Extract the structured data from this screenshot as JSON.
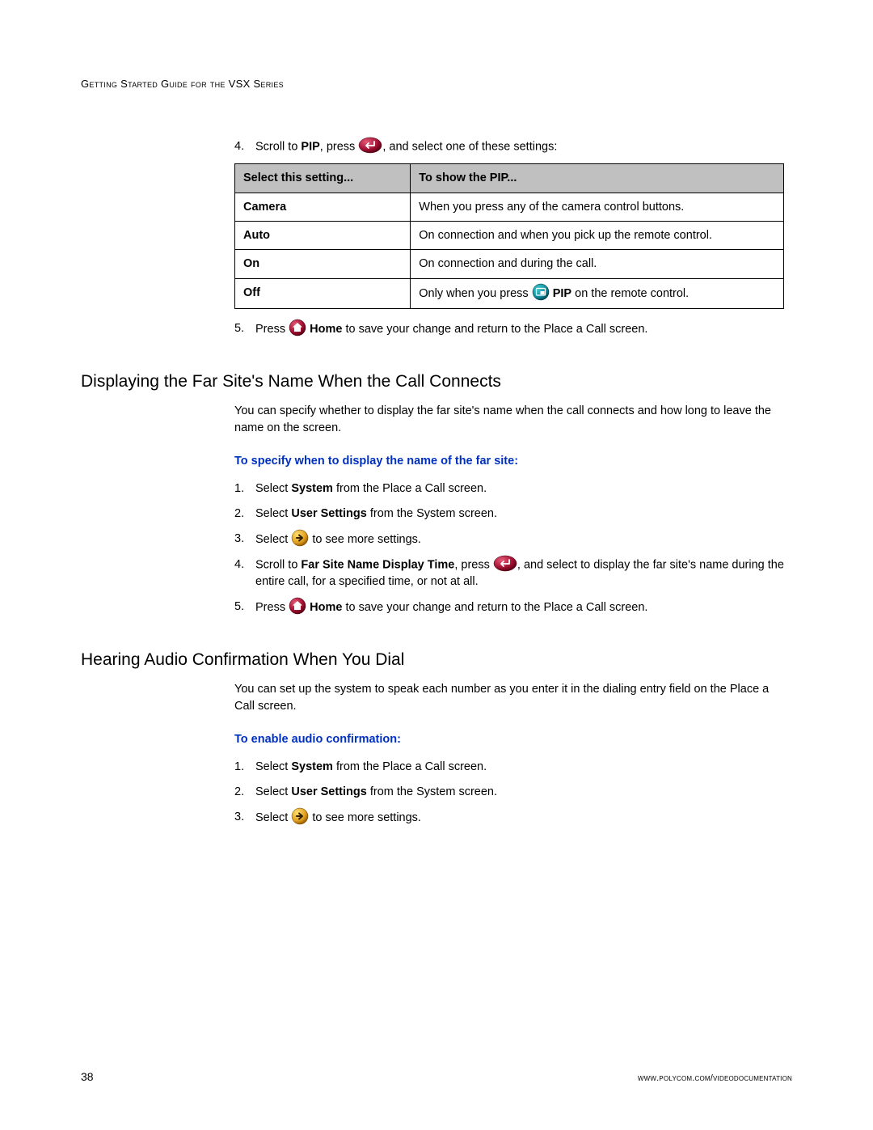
{
  "header": "Getting Started Guide for the VSX Series",
  "step4": {
    "num": "4.",
    "pre": "Scroll to ",
    "bold": "PIP",
    "mid": ", press ",
    "post": ", and select one of these settings:"
  },
  "table": {
    "h1": "Select this setting...",
    "h2": "To show the PIP...",
    "rows": [
      {
        "name": "Camera",
        "desc": "When you press any of the camera control buttons."
      },
      {
        "name": "Auto",
        "desc": "On connection and when you pick up the remote control."
      },
      {
        "name": "On",
        "desc": "On connection and during the call."
      },
      {
        "name": "Off",
        "desc_pre": "Only when you press ",
        "desc_bold": "PIP",
        "desc_post": " on the remote control."
      }
    ]
  },
  "step5": {
    "num": "5.",
    "pre": "Press ",
    "bold": "Home",
    "post": " to save your change and return to the Place a Call screen."
  },
  "sectionA": {
    "title": "Displaying the Far Site's Name When the Call Connects",
    "intro": "You can specify whether to display the far site's name when the call connects and how long to leave the name on the screen.",
    "task": "To specify when to display the name of the far site:",
    "s1": {
      "num": "1.",
      "pre": "Select ",
      "bold": "System",
      "post": " from the Place a Call screen."
    },
    "s2": {
      "num": "2.",
      "pre": "Select ",
      "bold": "User Settings",
      "post": " from the System screen."
    },
    "s3": {
      "num": "3.",
      "pre": "Select ",
      "post": " to see more settings."
    },
    "s4": {
      "num": "4.",
      "pre": "Scroll to ",
      "bold": "Far Site Name Display Time",
      "mid": ", press ",
      "post": ", and select to display the far site's name during the entire call, for a specified time, or not at all."
    },
    "s5": {
      "num": "5.",
      "pre": "Press ",
      "bold": "Home",
      "post": " to save your change and return to the Place a Call screen."
    }
  },
  "sectionB": {
    "title": "Hearing Audio Confirmation When You Dial",
    "intro": "You can set up the system to speak each number as you enter it in the dialing entry field on the Place a Call screen.",
    "task": "To enable audio confirmation:",
    "s1": {
      "num": "1.",
      "pre": "Select ",
      "bold": "System",
      "post": " from the Place a Call screen."
    },
    "s2": {
      "num": "2.",
      "pre": "Select ",
      "bold": "User Settings",
      "post": " from the System screen."
    },
    "s3": {
      "num": "3.",
      "pre": "Select ",
      "post": " to see more settings."
    }
  },
  "footer": {
    "page": "38",
    "url": "www.polycom.com/videodocumentation"
  }
}
